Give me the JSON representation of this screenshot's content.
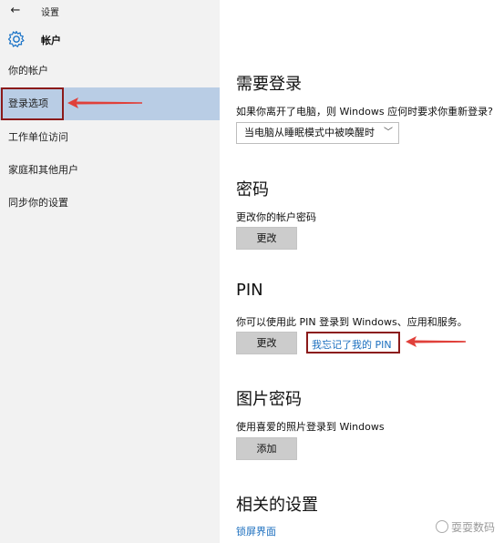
{
  "window": {
    "back_icon": "back-arrow-icon",
    "title": "设置"
  },
  "header": {
    "icon": "gear-icon",
    "title": "帐户"
  },
  "sidebar": {
    "items": [
      {
        "label": "你的帐户"
      },
      {
        "label": "登录选项",
        "active": true
      },
      {
        "label": "工作单位访问"
      },
      {
        "label": "家庭和其他用户"
      },
      {
        "label": "同步你的设置"
      }
    ]
  },
  "main": {
    "require_signin": {
      "title": "需要登录",
      "description": "如果你离开了电脑，则 Windows 应何时要求你重新登录?",
      "dropdown_value": "当电脑从睡眠模式中被唤醒时"
    },
    "password": {
      "title": "密码",
      "description": "更改你的帐户密码",
      "change_button": "更改"
    },
    "pin": {
      "title": "PIN",
      "description": "你可以使用此 PIN 登录到 Windows、应用和服务。",
      "change_button": "更改",
      "forgot_link": "我忘记了我的 PIN"
    },
    "picture_password": {
      "title": "图片密码",
      "description": "使用喜爱的照片登录到 Windows",
      "add_button": "添加"
    },
    "related": {
      "title": "相关的设置",
      "lock_screen_link": "锁屏界面"
    }
  },
  "watermark": {
    "text": "耍耍数码"
  },
  "colors": {
    "sidebar_bg": "#f2f2f2",
    "active_item_bg": "#b9cde5",
    "link": "#1c6fbf",
    "annotation_red": "#8b1a1a",
    "arrow_red": "#e0403a"
  }
}
